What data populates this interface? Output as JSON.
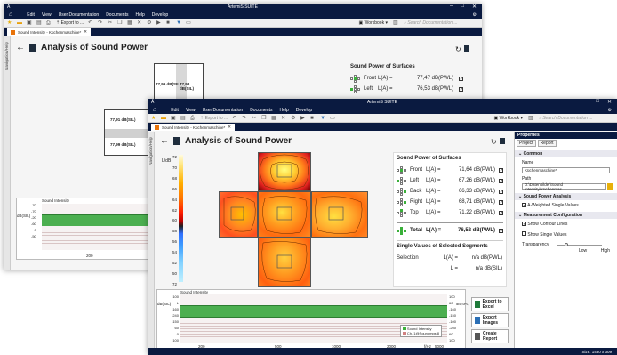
{
  "app": {
    "title": "ArtemiS SUITE",
    "logo": "Å",
    "window_controls": [
      "–",
      "□",
      "✕"
    ]
  },
  "menu": [
    "Edit",
    "View",
    "User Documentation",
    "Documents",
    "Help",
    "Develop"
  ],
  "toolbar": {
    "export_label": "Export to ...",
    "workbook_label": "Workbook",
    "search_placeholder": "Search Documentation ..."
  },
  "back_window": {
    "tab_label": "Sound Intensity - Küchenmaschine*",
    "page_title": "Analysis of Sound Power",
    "sidebar_label": "Navigation/Help",
    "surfaces_title": "Sound Power of Surfaces",
    "rows": [
      {
        "name": "Front",
        "formula": "L(A) =",
        "value": "77,47 dB(PWL)"
      },
      {
        "name": "Left",
        "formula": "L(A) =",
        "value": "76,53 dB(PWL)"
      }
    ],
    "diagram_labels": [
      "77,99 dB(SIL)",
      "77,98 dB(SIL)",
      "77,91 dB(SIL)",
      "77,99 dB(SIL)"
    ],
    "chart": {
      "title": "Sound Intensity",
      "ylabel": "dB(SIL)",
      "ticks": [
        "70",
        "-70",
        "-20",
        "-60",
        "0",
        "-50"
      ],
      "xtick": "200"
    }
  },
  "front_window": {
    "tab_label": "Sound Intensity - Küchenmaschine*",
    "page_title": "Analysis of Sound Power",
    "sidebar_label": "Navigation/Help",
    "colorbar": {
      "unit": "L/dB",
      "ticks": [
        "72",
        "70",
        "68",
        "66",
        "64",
        "62",
        "60",
        "58",
        "56",
        "54",
        "52",
        "50",
        "72"
      ]
    },
    "surfaces_title": "Sound Power of Surfaces",
    "rows": [
      {
        "name": "Front",
        "formula": "L(A) =",
        "value": "71,64 dB(PWL)"
      },
      {
        "name": "Left",
        "formula": "L(A) =",
        "value": "67,26 dB(PWL)"
      },
      {
        "name": "Back",
        "formula": "L(A) =",
        "value": "66,33 dB(PWL)"
      },
      {
        "name": "Right",
        "formula": "L(A) =",
        "value": "68,71 dB(PWL)"
      },
      {
        "name": "Top",
        "formula": "L(A) =",
        "value": "71,22 dB(PWL)"
      }
    ],
    "total": {
      "name": "Total",
      "formula": "L(A) =",
      "value": "76,52 dB(PWL)"
    },
    "segments_title": "Single Values of Selected Segments",
    "selection": {
      "label": "Selection",
      "formula": "L(A) =",
      "value": "n/a dB(PWL)"
    },
    "selection_l": {
      "formula": "L =",
      "value": "n/a dB(SIL)"
    },
    "chart": {
      "title": "Sound Intensity",
      "ylabel_left": "dB(SIL)",
      "ylabel_right": "dB(SPL)",
      "left_ticks": [
        "100",
        "L",
        "-160",
        "-240",
        "-150",
        "60",
        "0",
        "100"
      ],
      "right_ticks": [
        "100",
        "60",
        "-160",
        "-150",
        "-100",
        "-250",
        "60",
        "100"
      ],
      "xticks": [
        "200",
        "500",
        "1000",
        "2000"
      ],
      "xunit": "f/Hz",
      "xend": "5000",
      "legend": [
        "Sound Intensity",
        "Ch. 1@Soundmgs 8"
      ]
    },
    "buttons": [
      "Export to Excel",
      "Export Images",
      "Create Report"
    ]
  },
  "properties": {
    "title": "Properties",
    "tabs": [
      "Project",
      "Report"
    ],
    "common_title": "Common",
    "name_label": "Name",
    "name_value": "Küchenmaschine*",
    "path_label": "Path",
    "path_value": "D:\\Datenbilder\\Sound Intensity\\Küchenmas...",
    "spa_title": "Sound Power Analysis",
    "a_weighted": "A-Weighted Single Values",
    "mc_title": "Measurement Configuration",
    "show_contour": "Show Contour Lines",
    "show_single": "Show Single Values",
    "transparency": "Transparency",
    "low": "Low",
    "high": "High"
  },
  "status_text": "Size: 1430 x 309",
  "colors": {
    "navy": "#0a1a40",
    "green": "#3ab03a",
    "accent": "#e8730a"
  }
}
